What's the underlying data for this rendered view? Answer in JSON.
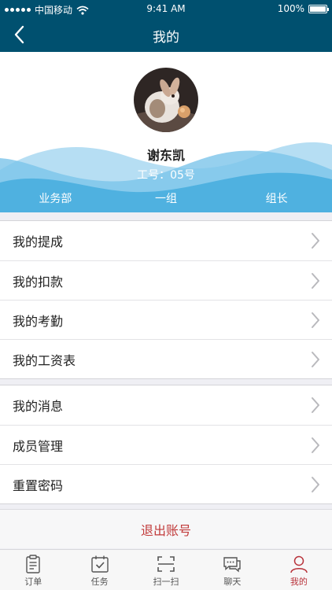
{
  "status_bar": {
    "carrier": "中国移动",
    "time": "9:41 AM",
    "battery": "100%",
    "battery_level": 1.0
  },
  "header": {
    "title": "我的"
  },
  "profile": {
    "name": "谢东凯",
    "job_number": "工号：05号",
    "department": "业务部",
    "group": "一组",
    "role": "组长"
  },
  "menu_group_1": [
    "我的提成",
    "我的扣款",
    "我的考勤",
    "我的工资表"
  ],
  "menu_group_2": [
    "我的消息",
    "成员管理",
    "重置密码"
  ],
  "logout_label": "退出账号",
  "tabs": [
    {
      "label": "订单",
      "icon": "clipboard-icon"
    },
    {
      "label": "任务",
      "icon": "calendar-check-icon"
    },
    {
      "label": "扫一扫",
      "icon": "scan-icon"
    },
    {
      "label": "聊天",
      "icon": "chat-icon"
    },
    {
      "label": "我的",
      "icon": "person-icon",
      "active": true
    }
  ],
  "colors": {
    "nav": "#00506f",
    "wave": "#4fb1e0",
    "accent": "#b8323a",
    "logout": "#c13a3a"
  }
}
